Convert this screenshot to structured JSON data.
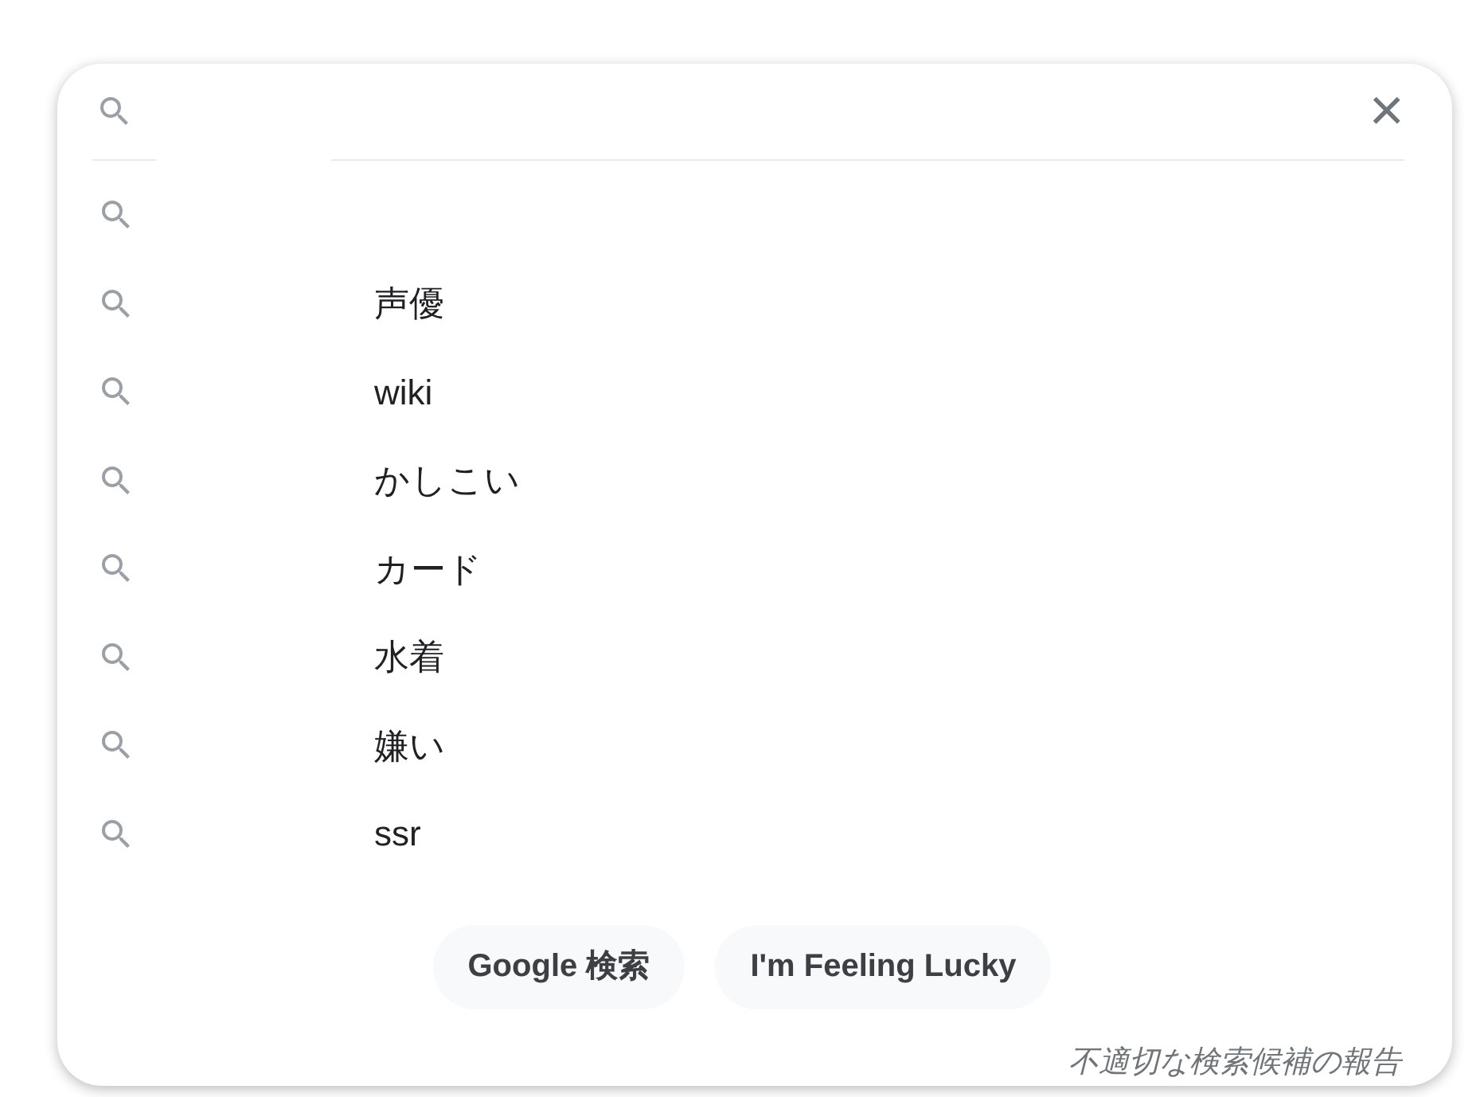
{
  "search": {
    "close_label": "×"
  },
  "suggestions": [
    {
      "kind": "blank"
    },
    {
      "kind": "text",
      "label": "声優"
    },
    {
      "kind": "text",
      "label": "wiki"
    },
    {
      "kind": "text",
      "label": "かしこい"
    },
    {
      "kind": "text",
      "label": "カード"
    },
    {
      "kind": "text",
      "label": "水着"
    },
    {
      "kind": "text",
      "label": "嫌い"
    },
    {
      "kind": "text",
      "label": "ssr"
    }
  ],
  "buttons": [
    "Google 検索",
    "I'm Feeling Lucky"
  ],
  "report_link": "不適切な検索候補の報告"
}
